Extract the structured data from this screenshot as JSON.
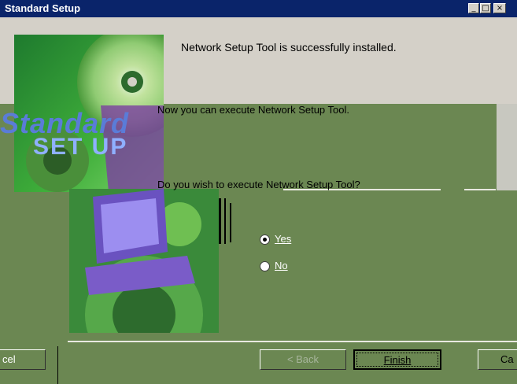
{
  "window": {
    "title": "Standard Setup",
    "minimize_glyph": "_",
    "maximize_glyph": "□",
    "close_glyph": "×"
  },
  "banner": {
    "logo_text_line1": "Standard",
    "logo_text_line2": "SET UP"
  },
  "content": {
    "installed_message": "Network Setup Tool is successfully installed.",
    "execute_message": "Now you can execute Network Setup Tool.",
    "question": "Do you wish to execute Network Setup Tool?"
  },
  "options": [
    {
      "label": "Yes",
      "selected": true
    },
    {
      "label": "No",
      "selected": false
    }
  ],
  "buttons": {
    "cancel_left_fragment": "cel",
    "back_label": "< Back",
    "finish_label": "Finish",
    "cancel_right_fragment": "Ca"
  },
  "colors": {
    "titlebar": "#0a246a",
    "dialog_gray": "#d4d0c8",
    "artifact_green": "#6b8752"
  }
}
